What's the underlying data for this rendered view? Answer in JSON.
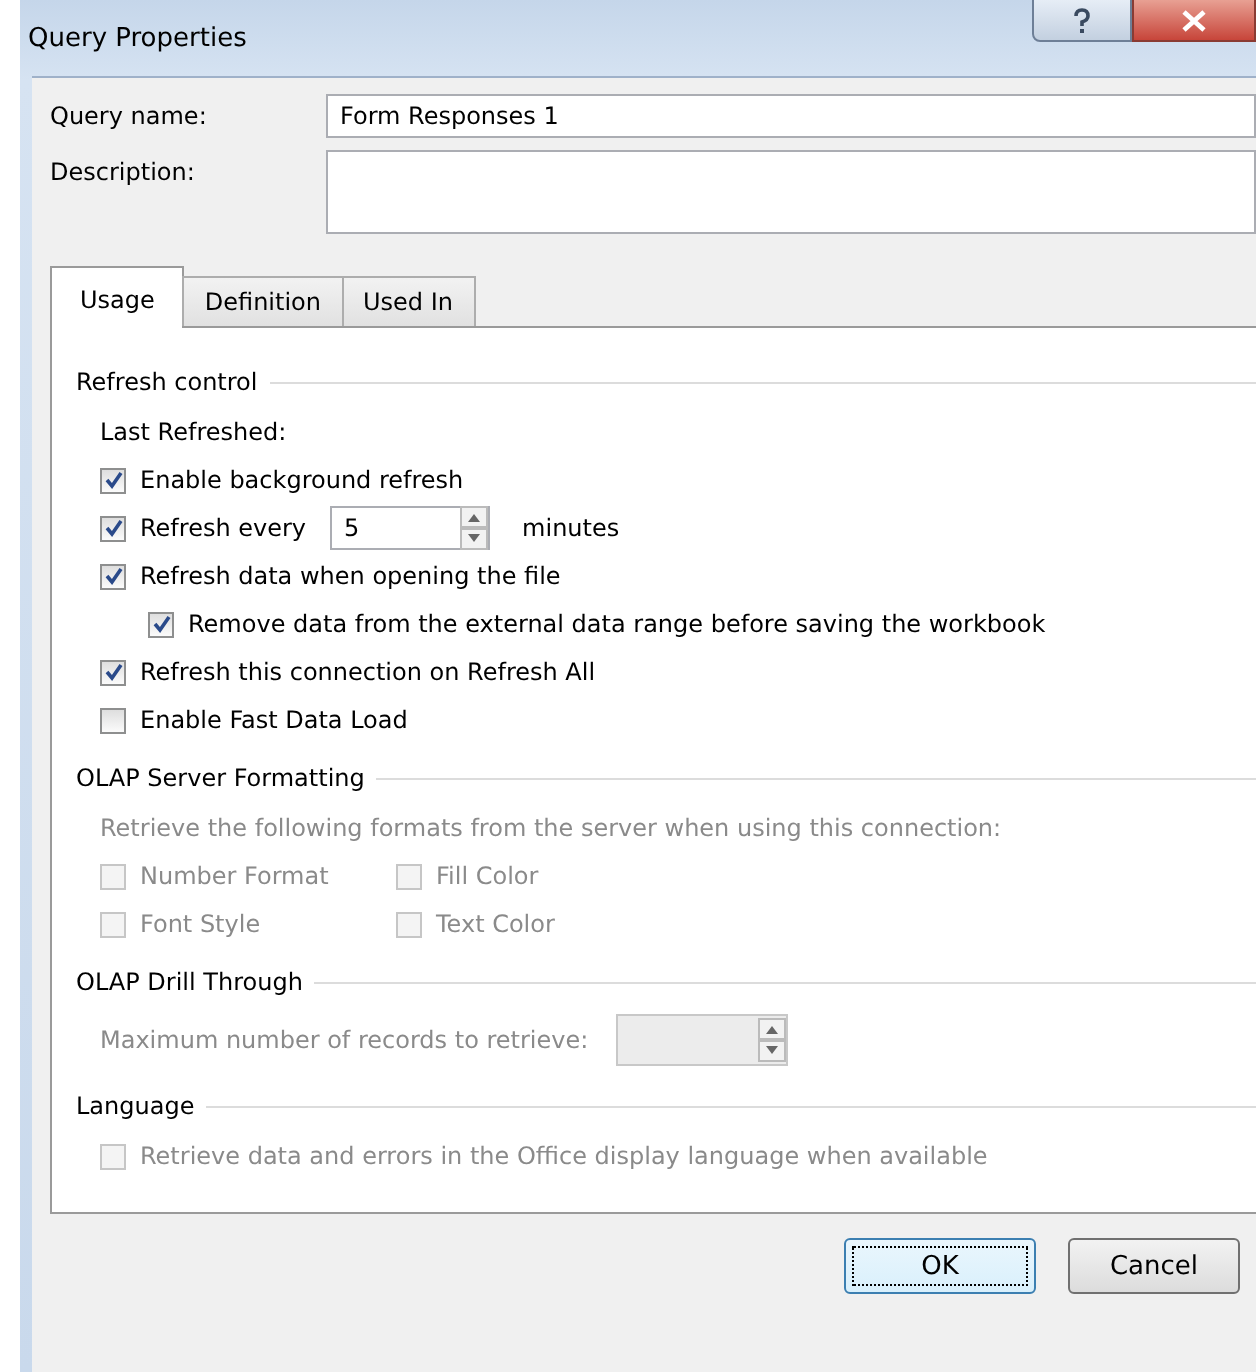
{
  "window": {
    "title": "Query Properties"
  },
  "fields": [
    {
      "label": "Query name:",
      "value": "Form Responses 1",
      "kind": "line"
    },
    {
      "label": "Description:",
      "kind": "area"
    }
  ],
  "tabs": [
    {
      "label": "Usage",
      "selected": true
    },
    {
      "label": "Definition",
      "selected": false
    },
    {
      "label": "Used In",
      "selected": false
    }
  ],
  "sections": [
    {
      "title": "Refresh control",
      "items": [
        {
          "kind": "text",
          "text": "Last Refreshed:",
          "disabled": false
        },
        {
          "kind": "checkbox",
          "label": "Enable background refresh",
          "checked": true,
          "disabled": false
        },
        {
          "kind": "checkbox_spin",
          "label": "Refresh every",
          "checked": true,
          "disabled": false,
          "value": "5",
          "unit": "minutes"
        },
        {
          "kind": "checkbox",
          "label": "Refresh data when opening the file",
          "checked": true,
          "disabled": false,
          "children": [
            {
              "kind": "checkbox",
              "label": "Remove data from the external data range before saving the workbook",
              "checked": true,
              "disabled": false
            }
          ]
        },
        {
          "kind": "checkbox",
          "label": "Refresh this connection on Refresh All",
          "checked": true,
          "disabled": false
        },
        {
          "kind": "checkbox",
          "label": "Enable Fast Data Load",
          "checked": false,
          "disabled": false
        }
      ]
    },
    {
      "title": "OLAP Server Formatting",
      "items": [
        {
          "kind": "text",
          "text": "Retrieve the following formats from the server when using this connection:",
          "disabled": true
        },
        {
          "kind": "checkbox_pair",
          "boxes": [
            {
              "label": "Number Format",
              "checked": false,
              "disabled": true
            },
            {
              "label": "Fill Color",
              "checked": false,
              "disabled": true
            }
          ]
        },
        {
          "kind": "checkbox_pair",
          "boxes": [
            {
              "label": "Font Style",
              "checked": false,
              "disabled": true
            },
            {
              "label": "Text Color",
              "checked": false,
              "disabled": true
            }
          ]
        }
      ]
    },
    {
      "title": "OLAP Drill Through",
      "items": [
        {
          "kind": "spin",
          "label": "Maximum number of records to retrieve:",
          "disabled": true
        }
      ]
    },
    {
      "title": "Language",
      "items": [
        {
          "kind": "checkbox",
          "label": "Retrieve data and errors in the Office display language when available",
          "checked": false,
          "disabled": true
        }
      ]
    }
  ],
  "buttons": [
    {
      "label": "OK",
      "default": true
    },
    {
      "label": "Cancel",
      "default": false
    }
  ]
}
